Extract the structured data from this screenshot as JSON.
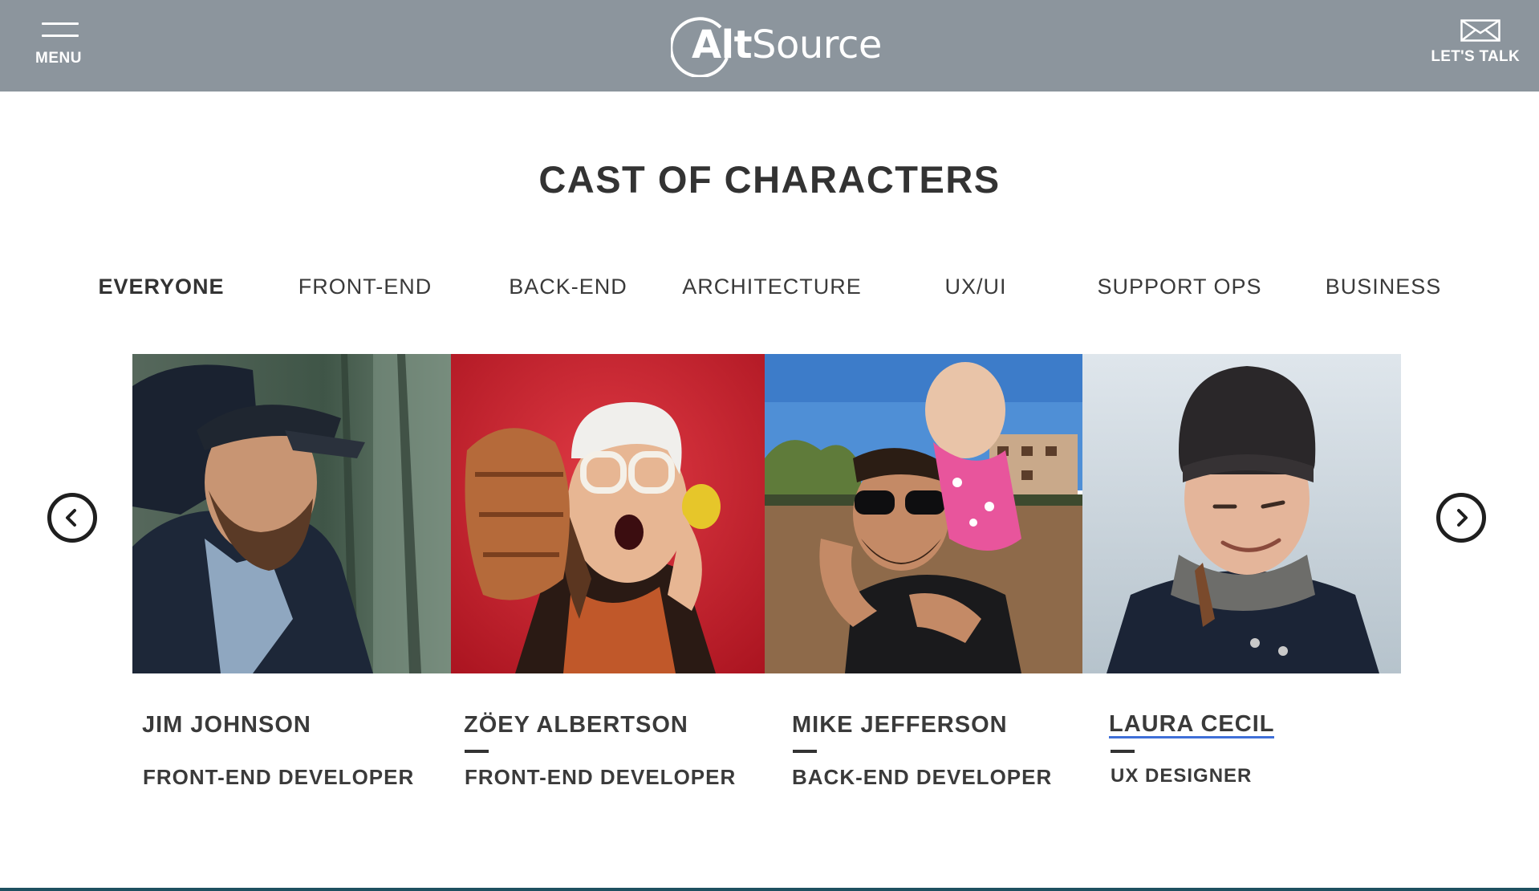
{
  "header": {
    "menu_label": "MENU",
    "logo": {
      "alt": "Alt",
      "source": "Source"
    },
    "contact_label": "LET'S TALK",
    "background": "#8c959d"
  },
  "title": "CAST OF CHARACTERS",
  "tabs": [
    {
      "label": "EVERYONE",
      "active": true
    },
    {
      "label": "FRONT-END",
      "active": false
    },
    {
      "label": "BACK-END",
      "active": false
    },
    {
      "label": "ARCHITECTURE",
      "active": false
    },
    {
      "label": "UX/UI",
      "active": false
    },
    {
      "label": "SUPPORT OPS",
      "active": false
    },
    {
      "label": "BUSINESS",
      "active": false
    }
  ],
  "carousel": {
    "prev_icon": "chevron-left-icon",
    "next_icon": "chevron-right-icon",
    "people": [
      {
        "name": "JIM JOHNSON",
        "role": "FRONT-END DEVELOPER",
        "photo": "man-with-cap-in-forest"
      },
      {
        "name": "ZÖEY ALBERTSON",
        "role": "FRONT-END DEVELOPER",
        "photo": "woman-with-tiki-mug-red-background"
      },
      {
        "name": "MIKE JEFFERSON",
        "role": "BACK-END DEVELOPER",
        "photo": "man-with-child-on-shoulders"
      },
      {
        "name": "LAURA CECIL",
        "role": "UX DESIGNER",
        "photo": "woman-in-beanie-winking"
      }
    ]
  },
  "colors": {
    "text": "#333333",
    "link_underline": "#3f6fd8",
    "footer": "#1e5060"
  }
}
